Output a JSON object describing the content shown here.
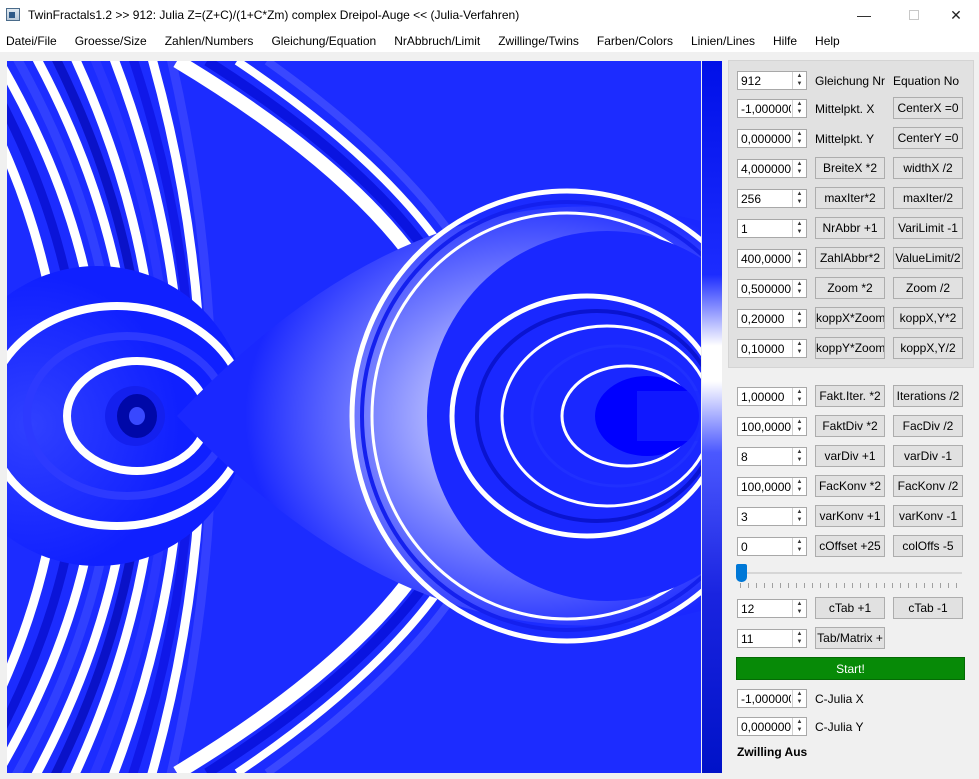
{
  "window": {
    "title": "TwinFractals1.2 >> 912: Julia Z=(Z+C)/(1+C*Zm) complex Dreipol-Auge << (Julia-Verfahren)",
    "minimize": "—",
    "close": "✕"
  },
  "menu": [
    "Datei/File",
    "Groesse/Size",
    "Zahlen/Numbers",
    "Gleichung/Equation",
    "NrAbbruch/Limit",
    "Zwillinge/Twins",
    "Farben/Colors",
    "Linien/Lines",
    "Hilfe",
    "Help"
  ],
  "params": {
    "equation": {
      "value": "912",
      "label1": "Gleichung Nr",
      "label2": "Equation No"
    },
    "center_x": {
      "value": "-1,0000000",
      "label": "Mittelpkt. X",
      "button": "CenterX =0"
    },
    "center_y": {
      "value": "0,0000000",
      "label": "Mittelpkt. Y",
      "button": "CenterY =0"
    },
    "width": {
      "value": "4,0000000",
      "button1": "BreiteX *2",
      "button2": "widthX /2"
    },
    "max_iter": {
      "value": "256",
      "button1": "maxIter*2",
      "button2": "maxIter/2"
    },
    "nr_abbr": {
      "value": "1",
      "button1": "NrAbbr +1",
      "button2": "VariLimit -1"
    },
    "zahl_abbr": {
      "value": "400,0000000",
      "button1": "ZahlAbbr*2",
      "button2": "ValueLimit/2"
    },
    "zoom": {
      "value": "0,5000000",
      "button1": "Zoom *2",
      "button2": "Zoom /2"
    },
    "kopp_x": {
      "value": "0,20000",
      "button1": "koppX*Zoom",
      "button2": "koppX,Y*2"
    },
    "kopp_y": {
      "value": "0,10000",
      "button1": "koppY*Zoom",
      "button2": "koppX,Y/2"
    }
  },
  "controls": {
    "fakt_iter": {
      "value": "1,00000",
      "button1": "Fakt.Iter. *2",
      "button2": "Iterations /2"
    },
    "fakt_div": {
      "value": "100,00000",
      "button1": "FaktDiv *2",
      "button2": "FacDiv /2"
    },
    "var_div": {
      "value": "8",
      "button1": "varDiv +1",
      "button2": "varDiv -1"
    },
    "fac_konv": {
      "value": "100,00000",
      "button1": "FacKonv *2",
      "button2": "FacKonv /2"
    },
    "var_konv": {
      "value": "3",
      "button1": "varKonv +1",
      "button2": "varKonv -1"
    },
    "c_offset": {
      "value": "0",
      "button1": "cOffset +25",
      "button2": "colOffs -5"
    },
    "slider_value": 0,
    "c_tab": {
      "value": "12",
      "button1": "cTab +1",
      "button2": "cTab -1"
    },
    "tab_matrix": {
      "value": "11",
      "button1": "Tab/Matrix +"
    },
    "start": "Start!",
    "c_julia_x": {
      "value": "-1,0000000",
      "label": "C-Julia X"
    },
    "c_julia_y": {
      "value": "0,0000000",
      "label": "C-Julia Y"
    },
    "status": "Zwilling Aus"
  },
  "colors": {
    "fractal_blue": "#0000ff",
    "start_green": "#078a07"
  }
}
